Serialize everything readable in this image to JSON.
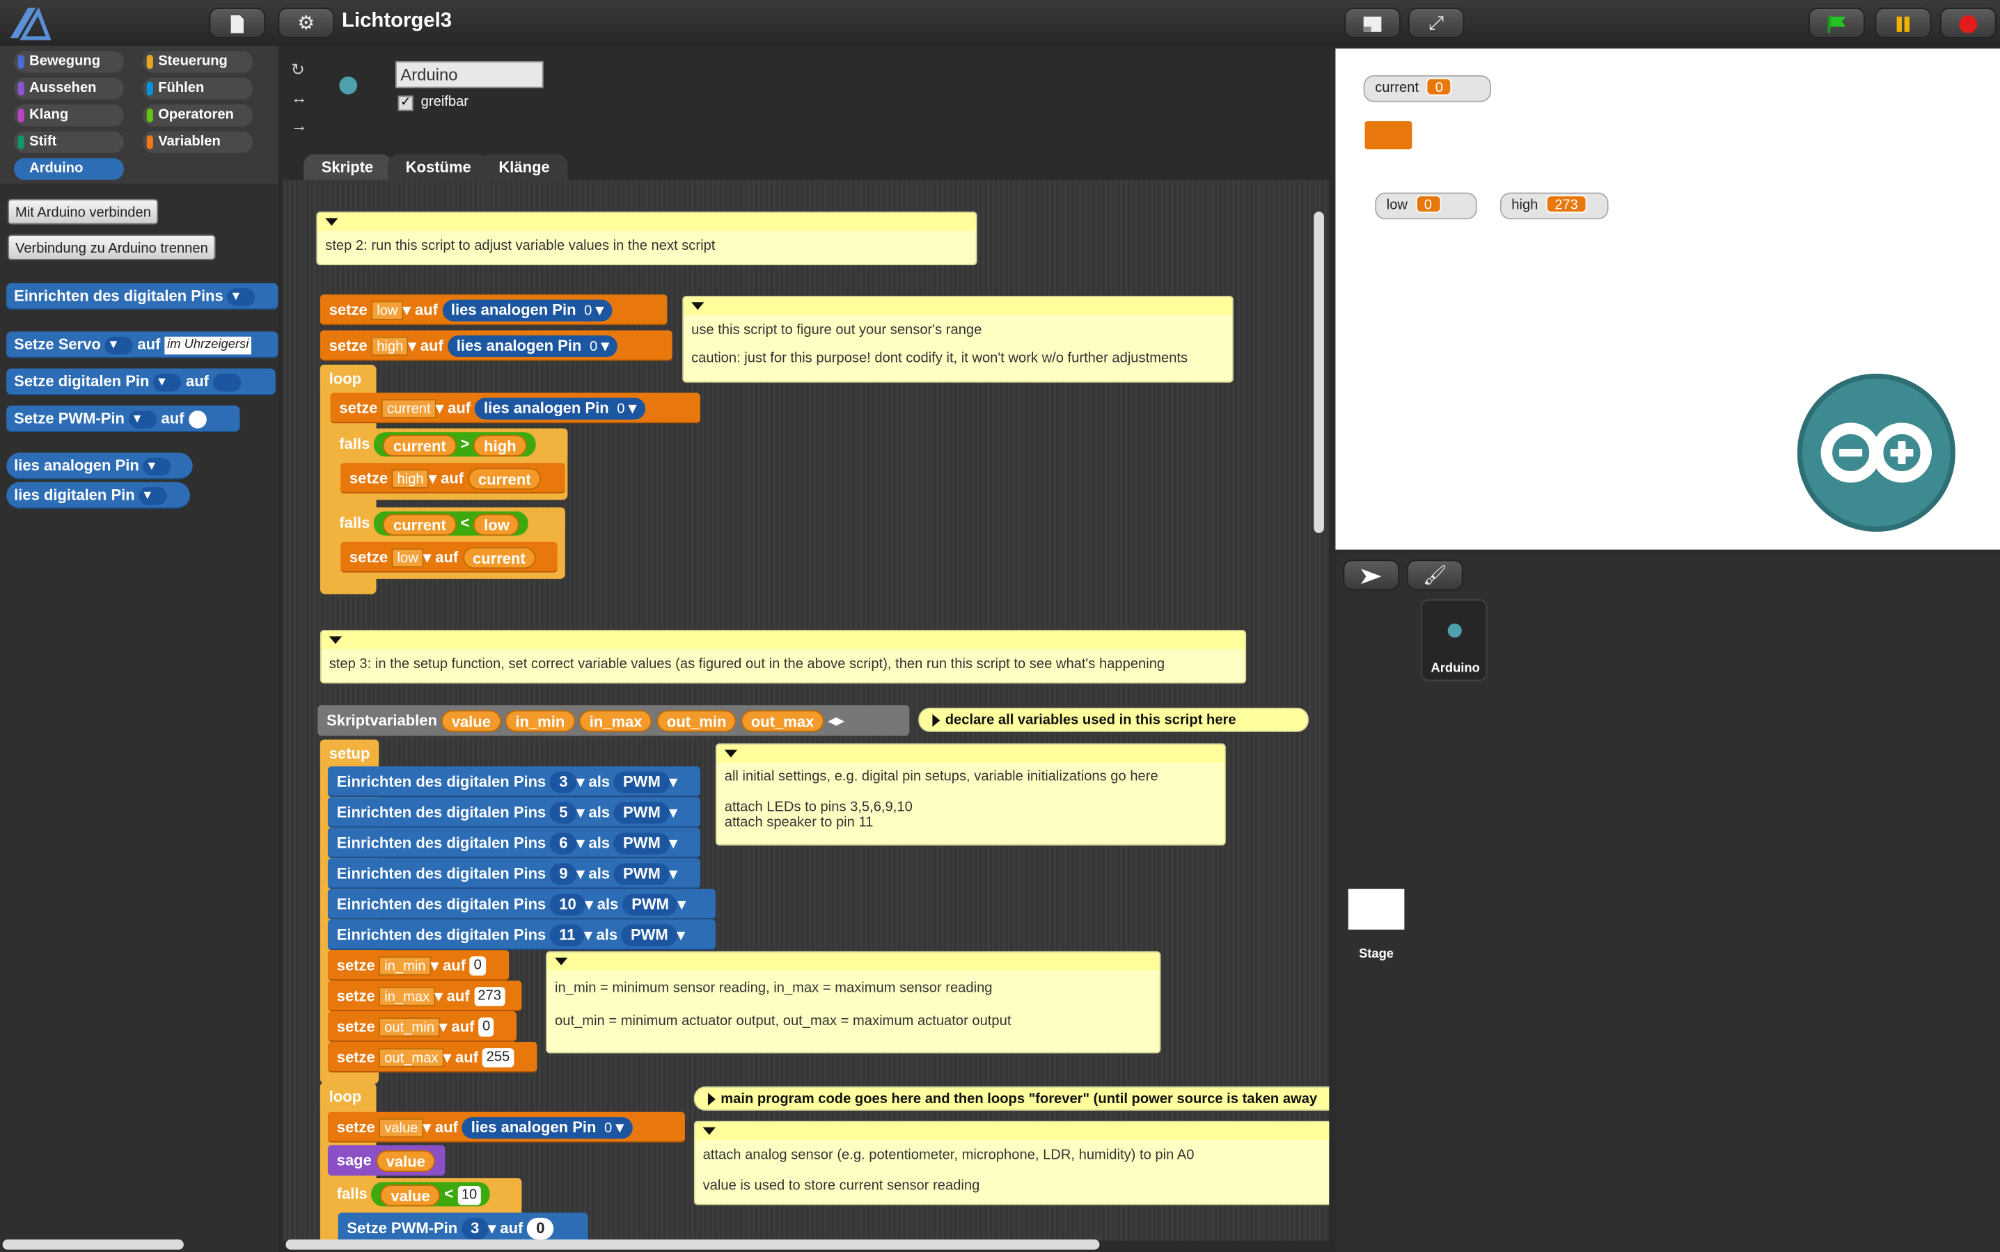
{
  "topbar": {
    "title": "Lichtorgel3",
    "file_icon": "file-icon",
    "settings_icon": "gear-icon"
  },
  "categories": [
    {
      "label": "Bewegung",
      "color": "#4a6cd4"
    },
    {
      "label": "Steuerung",
      "color": "#e6a822"
    },
    {
      "label": "Aussehen",
      "color": "#8a55d7"
    },
    {
      "label": "Fühlen",
      "color": "#0494dc"
    },
    {
      "label": "Klang",
      "color": "#bb42c3"
    },
    {
      "label": "Operatoren",
      "color": "#62c213"
    },
    {
      "label": "Stift",
      "color": "#0e9a6c"
    },
    {
      "label": "Variablen",
      "color": "#f3761d"
    },
    {
      "label": "Arduino",
      "color": "#2d6db5"
    }
  ],
  "palette": {
    "connect": "Mit Arduino verbinden",
    "disconnect": "Verbindung zu Arduino trennen",
    "blk_setup": "Einrichten des digitalen Pins",
    "blk_servo": "Setze Servo",
    "blk_servo_auf": "auf",
    "blk_servo_val": "im Uhrzeigersi",
    "blk_dig": "Setze digitalen Pin",
    "blk_dig_auf": "auf",
    "blk_pwm": "Setze PWM-Pin",
    "blk_pwm_auf": "auf",
    "blk_ana": "lies analogen Pin",
    "blk_digr": "lies digitalen Pin"
  },
  "sprite": {
    "name": "Arduino",
    "draggable_label": "greifbar"
  },
  "tabs": [
    "Skripte",
    "Kostüme",
    "Klänge"
  ],
  "scripts": {
    "note_step2": "step 2: run this script to adjust variable values in the next script",
    "s1_setze": "setze",
    "s1_low": "low",
    "s1_auf": "auf",
    "s1_lies": "lies analogen Pin",
    "s1_zero": "0",
    "s1_high": "high",
    "note_range1": "use this script to figure out your sensor's range",
    "note_range2": "caution: just for this purpose! dont codify it, it won't work w/o further adjustments",
    "loop": "loop",
    "current": "current",
    "falls": "falls",
    "gt": ">",
    "lt": "<",
    "note_step3": "step 3: in the setup function, set correct variable values (as figured out in the above script), then run this script to see what's happening",
    "skriptvar": "Skriptvariablen",
    "v_value": "value",
    "v_inmin": "in_min",
    "v_inmax": "in_max",
    "v_outmin": "out_min",
    "v_outmax": "out_max",
    "note_declare": "declare all variables used in this script here",
    "setup": "setup",
    "einr": "Einrichten des digitalen Pins",
    "als": "als",
    "pwm": "PWM",
    "pins": [
      "3",
      "5",
      "6",
      "9",
      "10",
      "11"
    ],
    "note_setup1": "all initial settings, e.g. digital pin setups, variable initializations go here",
    "note_setup2": "attach LEDs to pins 3,5,6,9,10",
    "note_setup3": "attach speaker to pin 11",
    "inmin_val": "0",
    "inmax_val": "273",
    "outmin_val": "0",
    "outmax_val": "255",
    "note_minmax1": "in_min = minimum sensor reading, in_max = maximum sensor reading",
    "note_minmax2": "out_min = minimum actuator output, out_max = maximum actuator output",
    "note_main": "main program code goes here and then loops \"forever\" (until power source is taken away",
    "note_sensor1": "attach analog sensor (e.g. potentiometer, microphone, LDR, humidity) to pin A0",
    "note_sensor2": "value is used to store current sensor reading",
    "sage": "sage",
    "ten": "10",
    "pwm_pin": "Setze PWM-Pin",
    "three": "3",
    "zero": "0"
  },
  "stage": {
    "watchers": [
      {
        "label": "current",
        "value": "0"
      },
      {
        "label": "low",
        "value": "0"
      },
      {
        "label": "high",
        "value": "273"
      }
    ]
  },
  "corral": {
    "sprite_label": "Arduino",
    "stage_label": "Stage"
  }
}
